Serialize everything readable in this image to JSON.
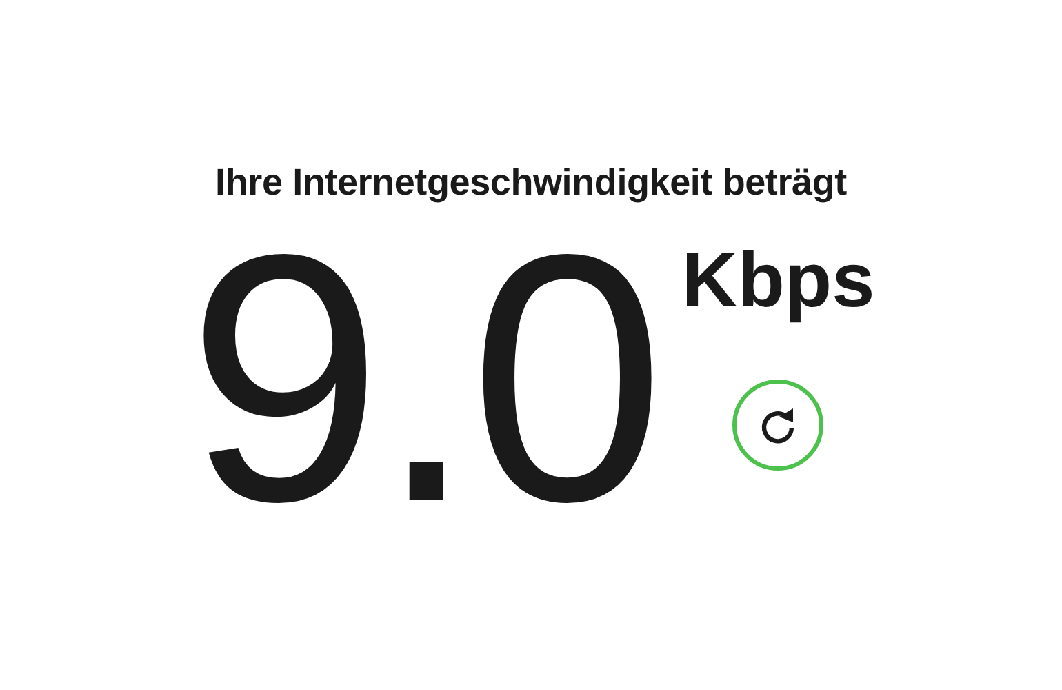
{
  "heading": "Ihre Internetgeschwindigkeit beträgt",
  "speed": {
    "value": "9.0",
    "unit": "Kbps"
  },
  "refresh_button": {
    "disabled": false
  }
}
